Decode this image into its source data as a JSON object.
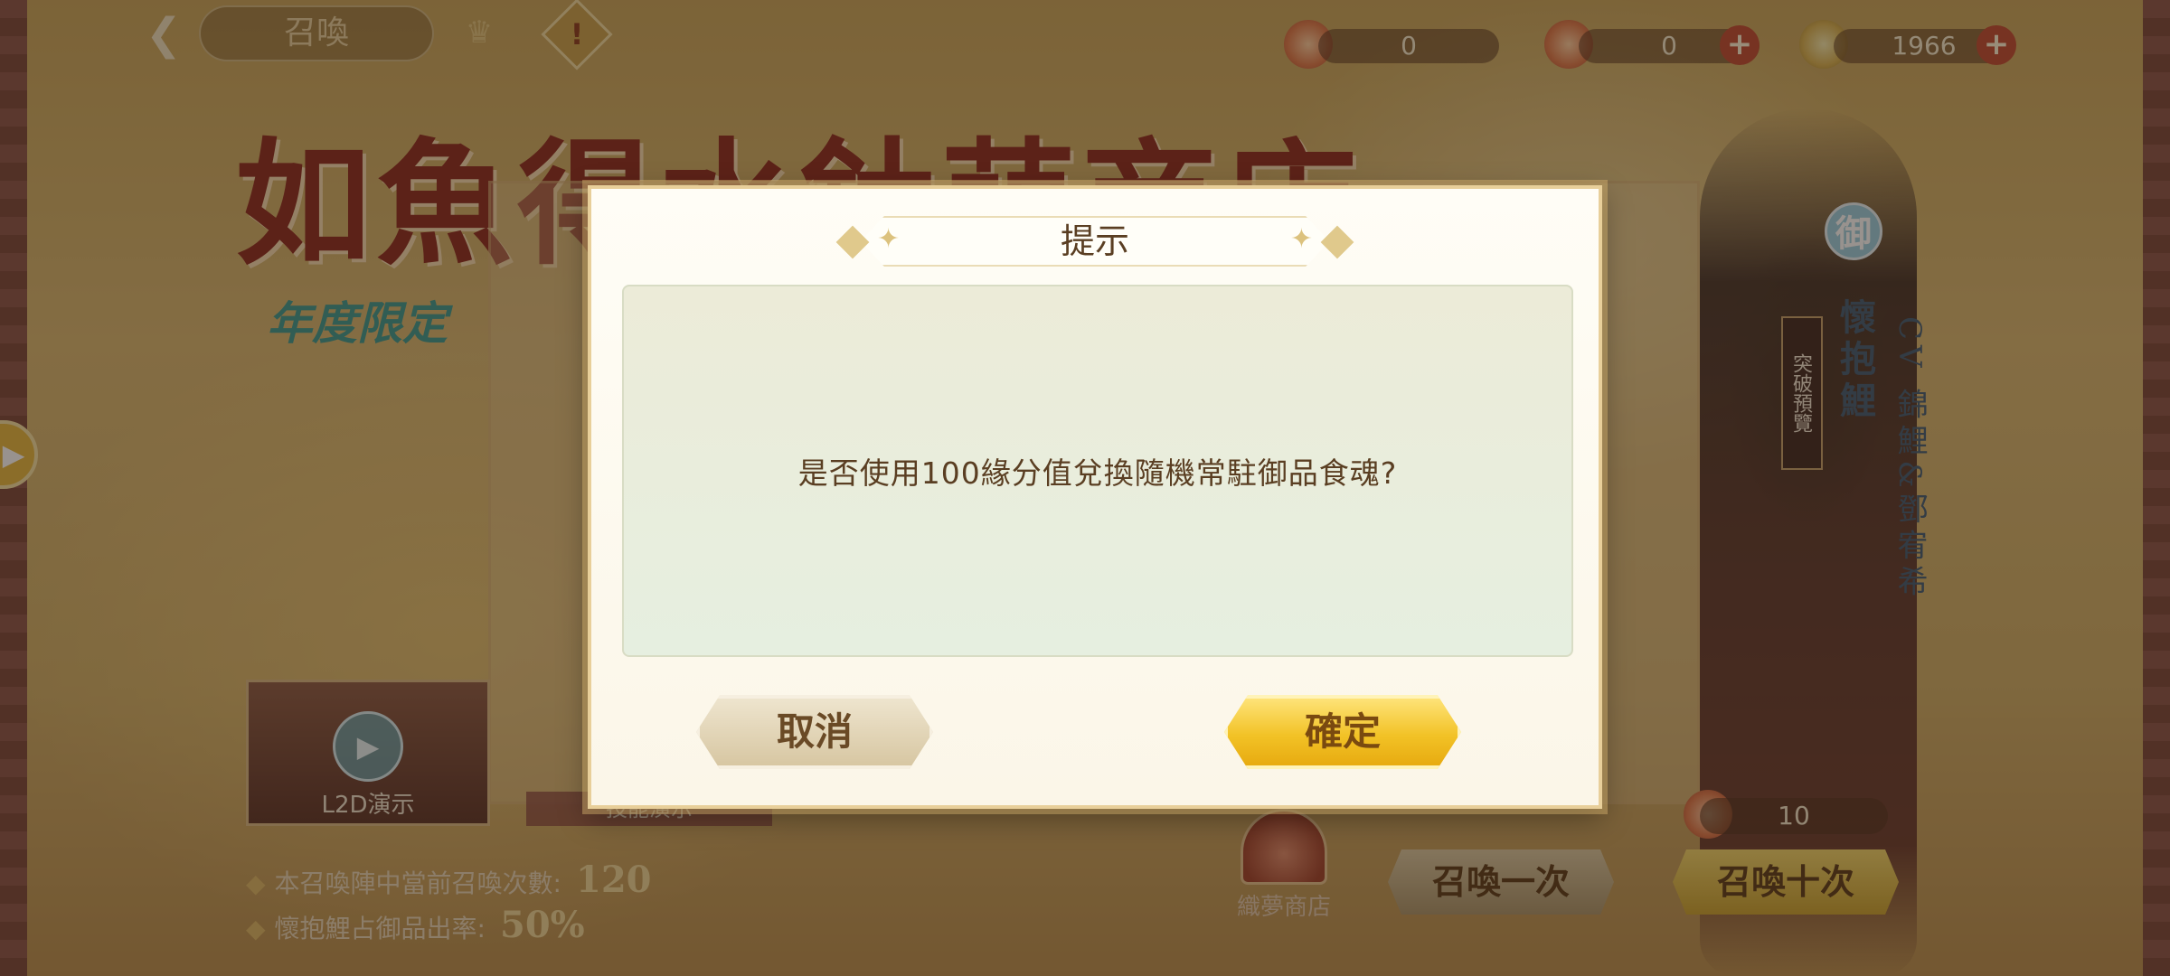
{
  "header": {
    "back_icon": "back-arrow-icon",
    "title": "召喚",
    "crown_icon": "crown-icon",
    "alert_symbol": "!"
  },
  "currencies": [
    {
      "name": "currency-a",
      "value": "0"
    },
    {
      "name": "currency-b",
      "value": "0"
    },
    {
      "name": "currency-c",
      "value": "1966"
    }
  ],
  "banner": {
    "title": "如魚得水鈦萌商店",
    "subtitle": "年度限定"
  },
  "l2d": {
    "label": "L2D演示",
    "preview_label": "技能演示"
  },
  "info": {
    "summon_count_label": "本召喚陣中當前召喚次數:",
    "summon_count_value": "120",
    "rate_label": "懷抱鯉占御品出率:",
    "rate_value": "50%"
  },
  "shop_label": "織夢商店",
  "summon": {
    "one_label": "召喚一次",
    "ten_label": "召喚十次",
    "ticket_count": "10"
  },
  "character": {
    "badge": "御",
    "name": "懷抱鯉",
    "cv": "CV 錦鯉&鄧宥希",
    "breakthrough": "突破預覽"
  },
  "dialog": {
    "title": "提示",
    "message": "是否使用100緣分值兌換隨機常駐御品食魂?",
    "cancel_label": "取消",
    "confirm_label": "確定"
  },
  "colors": {
    "confirm_button": "#f2c226",
    "cancel_button": "#d6c5a0",
    "dialog_text": "#5a3e22"
  }
}
